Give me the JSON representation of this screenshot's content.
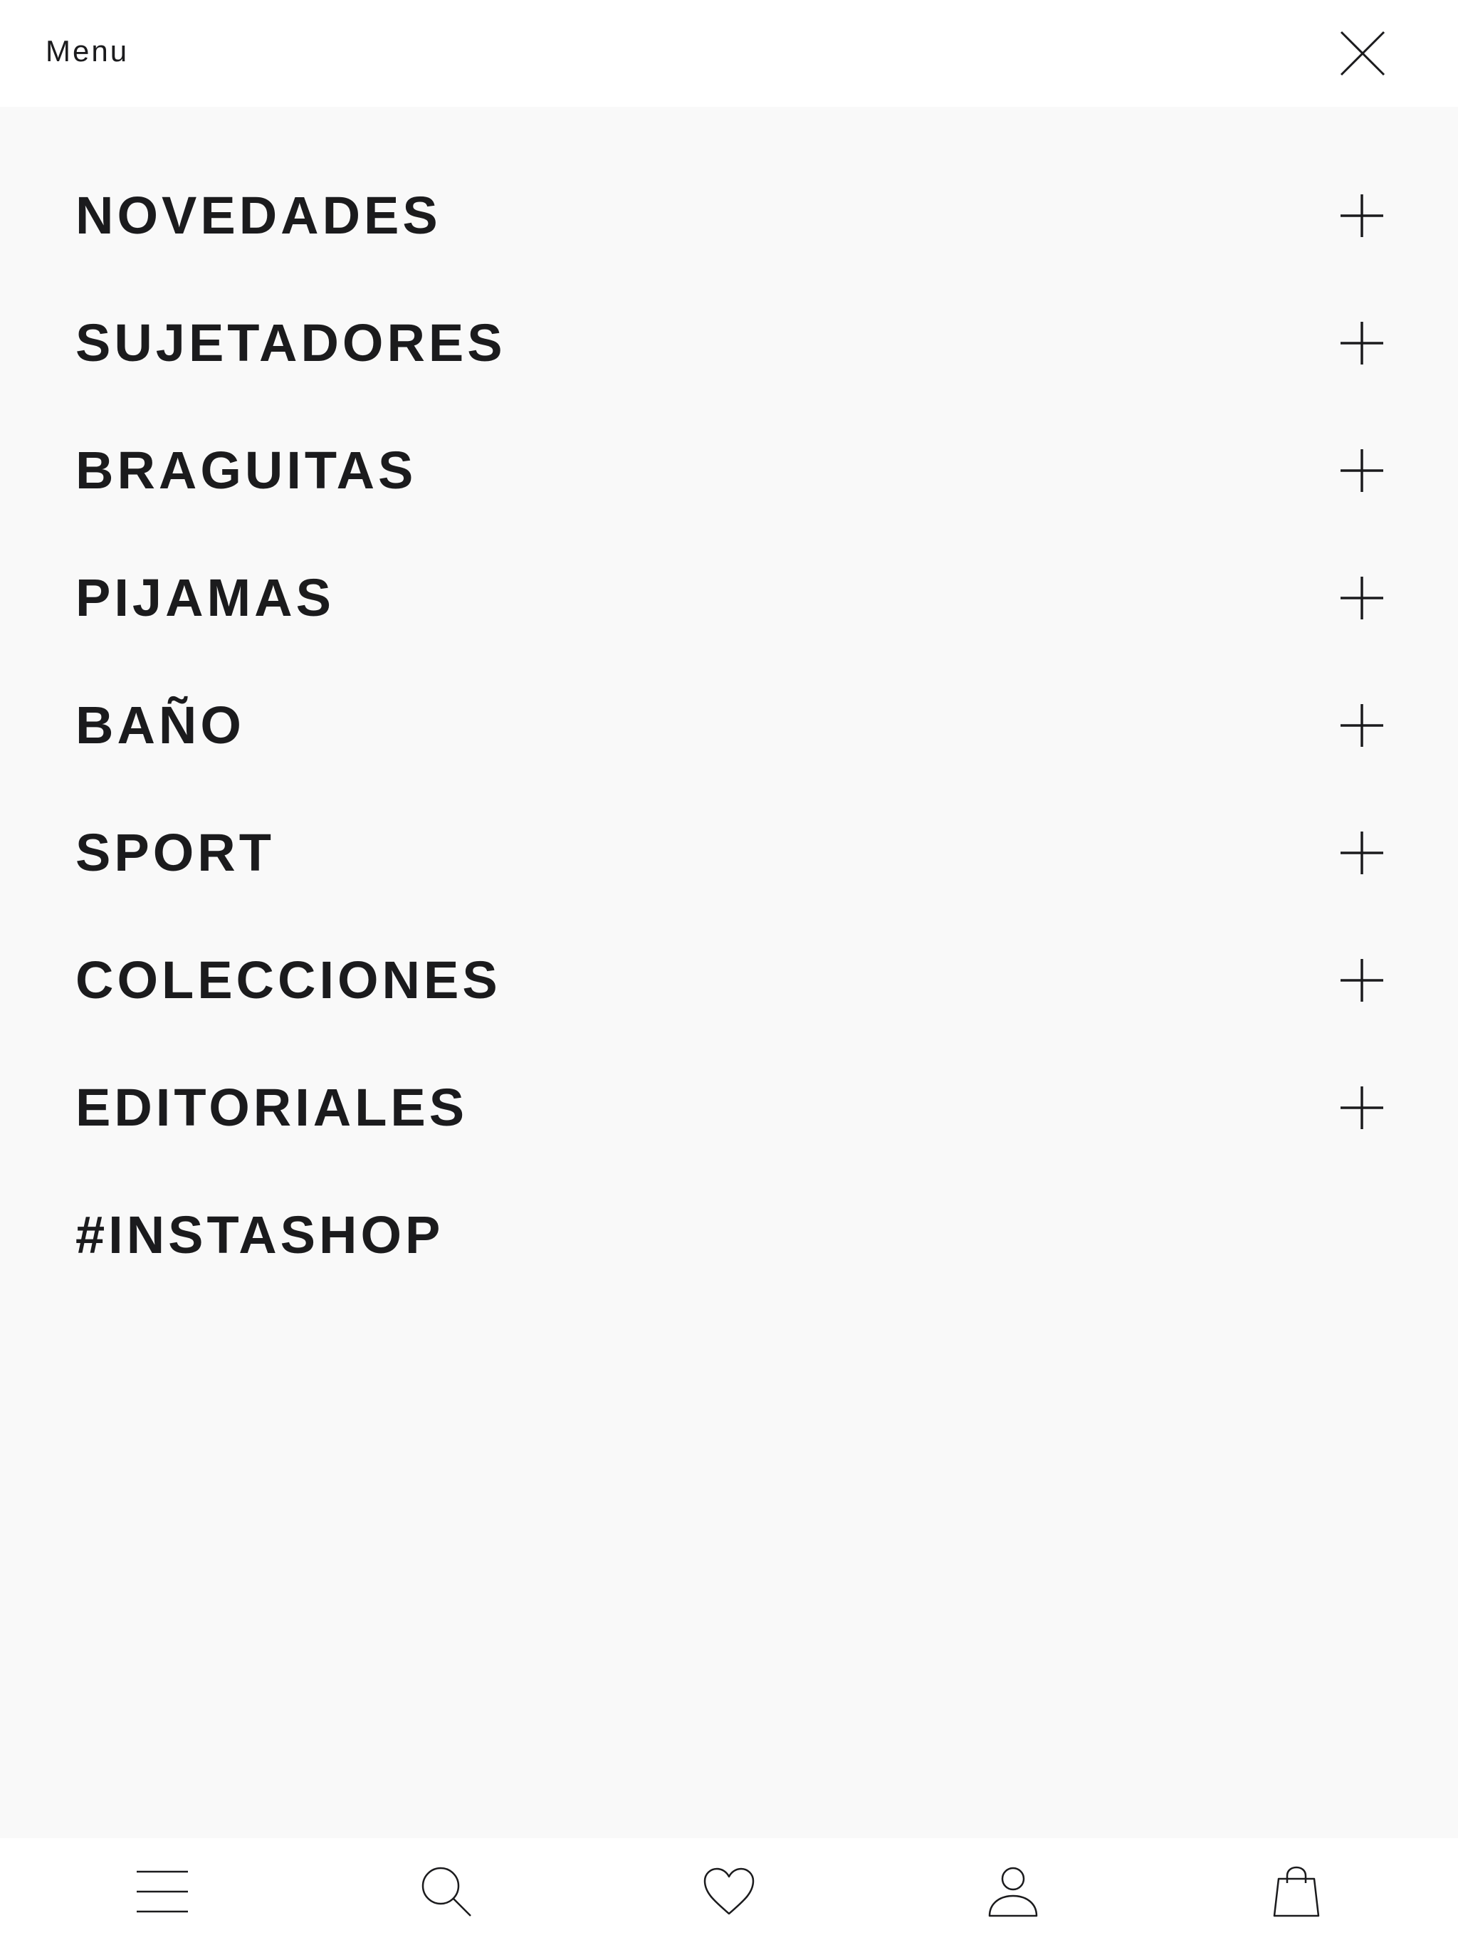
{
  "header": {
    "title": "Menu",
    "close_icon": "close-icon"
  },
  "menu": {
    "items": [
      {
        "label": "NOVEDADES",
        "expandable": true
      },
      {
        "label": "SUJETADORES",
        "expandable": true
      },
      {
        "label": "BRAGUITAS",
        "expandable": true
      },
      {
        "label": "PIJAMAS",
        "expandable": true
      },
      {
        "label": "BAÑO",
        "expandable": true
      },
      {
        "label": "SPORT",
        "expandable": true
      },
      {
        "label": "COLECCIONES",
        "expandable": true
      },
      {
        "label": "EDITORIALES",
        "expandable": true
      },
      {
        "label": "#INSTASHOP",
        "expandable": false
      }
    ]
  },
  "bottom_nav": {
    "items": [
      {
        "icon": "hamburger-menu-icon"
      },
      {
        "icon": "search-icon"
      },
      {
        "icon": "heart-icon"
      },
      {
        "icon": "user-icon"
      },
      {
        "icon": "shopping-bag-icon"
      }
    ]
  },
  "colors": {
    "text": "#1b1b1d",
    "panel_background": "#f9f9f9",
    "header_background": "#ffffff"
  }
}
